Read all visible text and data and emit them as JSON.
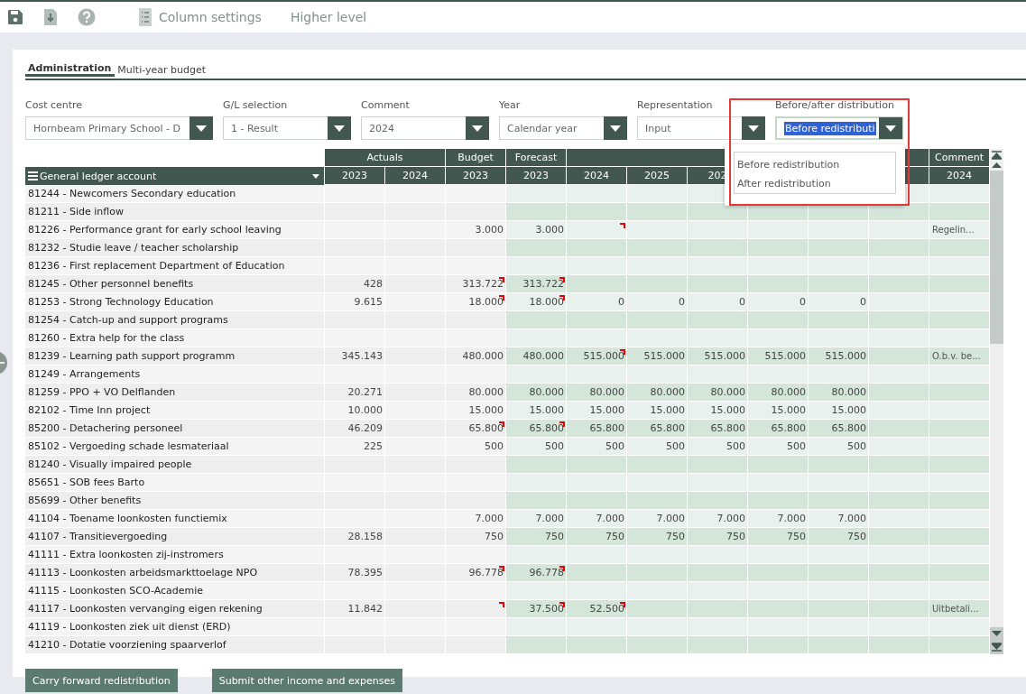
{
  "toolbar": {
    "items": [
      {
        "kind": "icon-text",
        "label": "Column settings"
      },
      {
        "kind": "text",
        "label": "Higher level"
      }
    ]
  },
  "tabs": [
    {
      "label": "Administration",
      "selected": true
    },
    {
      "label": "Multi-year budget",
      "selected": false
    }
  ],
  "filters": [
    {
      "label": "Cost centre",
      "value": "Hornbeam Primary School - D",
      "focused": false
    },
    {
      "label": "G/L selection",
      "value": "1 - Result",
      "focused": false
    },
    {
      "label": "Comment",
      "value": "2024",
      "focused": false
    },
    {
      "label": "Year",
      "value": "Calendar year",
      "focused": false
    },
    {
      "label": "Representation",
      "value": "Input",
      "focused": false
    },
    {
      "label": "Before/after distribution",
      "value": "Before redistributi",
      "focused": true
    }
  ],
  "dropdown": {
    "highlighted": true,
    "options": [
      "Before redistribution",
      "After redistribution"
    ]
  },
  "table": {
    "first_column": "General ledger account",
    "column_groups": [
      {
        "label": "Actuals",
        "years": [
          "2023",
          "2024"
        ]
      },
      {
        "label": "Budget",
        "years": [
          "2023"
        ]
      },
      {
        "label": "Forecast",
        "years": [
          "2023"
        ]
      },
      {
        "years": [
          "2024",
          "2025",
          "202"
        ]
      },
      {
        "label": "Comment",
        "years": [
          "2024"
        ]
      }
    ],
    "rows": [
      {
        "account": "81244 - Newcomers Secondary education",
        "cells": [
          null,
          null,
          null,
          null,
          null,
          null,
          null,
          null,
          null,
          null,
          null
        ]
      },
      {
        "account": "81211 - Side inflow",
        "cells": [
          null,
          null,
          null,
          null,
          null,
          null,
          null,
          null,
          null,
          null,
          null
        ]
      },
      {
        "account": "81226 - Performance grant for early school leaving",
        "cells": [
          null,
          null,
          "3.000",
          "3.000",
          {
            "flag": true
          },
          null,
          null,
          null,
          null,
          null,
          "Regelin..."
        ]
      },
      {
        "account": "81232 - Studie leave / teacher scholarship",
        "cells": [
          null,
          null,
          null,
          null,
          null,
          null,
          null,
          null,
          null,
          null,
          null
        ]
      },
      {
        "account": "81236 - First replacement Department of Education",
        "cells": [
          null,
          null,
          null,
          null,
          null,
          null,
          null,
          null,
          null,
          null,
          null
        ]
      },
      {
        "account": "81245 - Other personnel benefits",
        "cells": [
          "428",
          null,
          {
            "text": "313.722",
            "flag": true
          },
          {
            "text": "313.722",
            "flag": true
          },
          null,
          null,
          null,
          null,
          null,
          null,
          null
        ]
      },
      {
        "account": "81253 - Strong Technology Education",
        "cells": [
          "9.615",
          null,
          {
            "text": "18.000",
            "flag": true
          },
          {
            "text": "18.000",
            "flag": true
          },
          "0",
          "0",
          "0",
          "0",
          "0",
          null,
          null
        ]
      },
      {
        "account": "81254 - Catch-up and support programs",
        "cells": [
          null,
          null,
          null,
          null,
          null,
          null,
          null,
          null,
          null,
          null,
          null
        ]
      },
      {
        "account": "81260 - Extra help for the class",
        "cells": [
          null,
          null,
          null,
          null,
          null,
          null,
          null,
          null,
          null,
          null,
          null
        ]
      },
      {
        "account": "81239 - Learning path support programm",
        "cells": [
          "345.143",
          null,
          "480.000",
          "480.000",
          {
            "text": "515.000",
            "flag": true
          },
          "515.000",
          "515.000",
          "515.000",
          "515.000",
          null,
          "O.b.v. be..."
        ]
      },
      {
        "account": "81249 - Arrangements",
        "cells": [
          null,
          null,
          null,
          null,
          null,
          null,
          null,
          null,
          null,
          null,
          null
        ]
      },
      {
        "account": "81259 - PPO + VO Delflanden",
        "cells": [
          "20.271",
          null,
          "80.000",
          "80.000",
          "80.000",
          "80.000",
          "80.000",
          "80.000",
          "80.000",
          null,
          null
        ]
      },
      {
        "account": "82102 - Time Inn project",
        "cells": [
          "10.000",
          null,
          "15.000",
          "15.000",
          "15.000",
          "15.000",
          "15.000",
          "15.000",
          "15.000",
          null,
          null
        ]
      },
      {
        "account": "85200 - Detachering personeel",
        "cells": [
          "46.209",
          null,
          {
            "text": "65.800",
            "flag": true
          },
          {
            "text": "65.800",
            "flag": true
          },
          "65.800",
          "65.800",
          "65.800",
          "65.800",
          "65.800",
          null,
          null
        ]
      },
      {
        "account": "85102 - Vergoeding schade lesmateriaal",
        "cells": [
          "225",
          null,
          "500",
          "500",
          "500",
          "500",
          "500",
          "500",
          "500",
          null,
          null
        ]
      },
      {
        "account": "81240 - Visually impaired people",
        "cells": [
          null,
          null,
          null,
          null,
          null,
          null,
          null,
          null,
          null,
          null,
          null
        ]
      },
      {
        "account": "85651 - SOB fees Barto",
        "cells": [
          null,
          null,
          null,
          null,
          null,
          null,
          null,
          null,
          null,
          null,
          null
        ]
      },
      {
        "account": "85699 - Other benefits",
        "cells": [
          null,
          null,
          null,
          null,
          null,
          null,
          null,
          null,
          null,
          null,
          null
        ]
      },
      {
        "account": "41104 - Toename loonkosten functiemix",
        "cells": [
          null,
          null,
          "7.000",
          "7.000",
          "7.000",
          "7.000",
          "7.000",
          "7.000",
          "7.000",
          null,
          null
        ]
      },
      {
        "account": "41107 - Transitievergoeding",
        "cells": [
          "28.158",
          null,
          "750",
          "750",
          "750",
          "750",
          "750",
          "750",
          "750",
          null,
          null
        ]
      },
      {
        "account": "41111 - Extra loonkosten zij-instromers",
        "cells": [
          null,
          null,
          null,
          null,
          null,
          null,
          null,
          null,
          null,
          null,
          null
        ]
      },
      {
        "account": "41113 - Loonkosten arbeidsmarkttoelage NPO",
        "cells": [
          "78.395",
          null,
          {
            "text": "96.778",
            "flag": true
          },
          {
            "text": "96.778",
            "flag": true
          },
          null,
          null,
          null,
          null,
          null,
          null,
          null
        ]
      },
      {
        "account": "41115 - Loonkosten SCO-Academie",
        "cells": [
          null,
          null,
          null,
          null,
          null,
          null,
          null,
          null,
          null,
          null,
          null
        ]
      },
      {
        "account": "41117 - Loonkosten vervanging eigen rekening",
        "cells": [
          "11.842",
          null,
          {
            "flag": true
          },
          {
            "text": "37.500",
            "flag": true
          },
          {
            "text": "52.500",
            "flag": true
          },
          null,
          null,
          null,
          null,
          null,
          "Uitbetali..."
        ]
      },
      {
        "account": "41119 - Loonkosten ziek uit dienst (ERD)",
        "cells": [
          null,
          null,
          null,
          null,
          null,
          null,
          null,
          null,
          null,
          null,
          null
        ]
      },
      {
        "account": "41210 - Dotatie voorziening spaarverlof",
        "cells": [
          null,
          null,
          null,
          null,
          null,
          null,
          null,
          null,
          null,
          null,
          null
        ]
      }
    ]
  },
  "buttons": [
    "Carry forward redistribution",
    "Submit other income and expenses"
  ]
}
